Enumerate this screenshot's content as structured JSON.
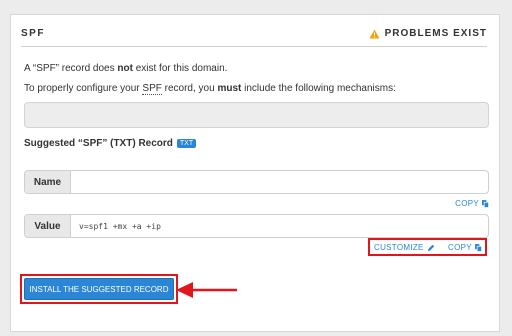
{
  "section": {
    "title": "SPF",
    "status": "PROBLEMS EXIST",
    "status_icon": "warning-icon",
    "status_color": "#f0a30a"
  },
  "messages": {
    "line1_pre": "A “SPF” record does ",
    "line1_bold": "not",
    "line1_post": " exist for this domain.",
    "line2_pre": "To properly configure your ",
    "line2_abbr": "SPF",
    "line2_mid": " record, you ",
    "line2_bold": "must",
    "line2_post": " include the following mechanisms:"
  },
  "suggested": {
    "heading": "Suggested “SPF” (TXT) Record",
    "badge": "TXT"
  },
  "record": {
    "name_label": "Name",
    "name_value": "",
    "value_label": "Value",
    "value_value": "v=spf1 +mx +a +ip"
  },
  "actions": {
    "copy_label": "COPY",
    "customize_label": "CUSTOMIZE",
    "install_label": "INSTALL THE SUGGESTED RECORD"
  },
  "colors": {
    "accent": "#2b86d6",
    "highlight": "#e0161c"
  }
}
